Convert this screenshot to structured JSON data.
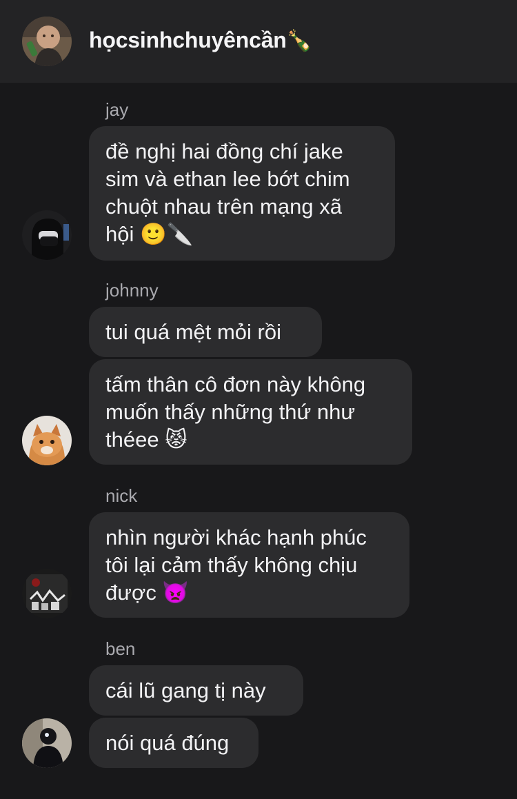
{
  "header": {
    "title": "họcsinhchuyêncần",
    "title_emoji": "🍾",
    "avatar_icon": "group-avatar-photo"
  },
  "messages": [
    {
      "sender": "jay",
      "bubbles": [
        {
          "lines": [
            "đề nghị hai đồng chí jake",
            "sim và ethan lee bớt chim",
            "chuột nhau trên mạng xã",
            "hội 🙂🔪"
          ]
        }
      ],
      "avatar_icon": "masked-person-avatar"
    },
    {
      "sender": "johnny",
      "bubbles": [
        {
          "lines": [
            "tui quá mệt mỏi rồi"
          ]
        },
        {
          "lines": [
            "tấm thân cô đơn này không",
            "muốn thấy những thứ như",
            "théee 😾"
          ]
        }
      ],
      "avatar_icon": "cat-avatar"
    },
    {
      "sender": "nick",
      "bubbles": [
        {
          "lines": [
            "nhìn người khác hạnh phúc",
            "tôi lại cảm thấy không chịu",
            "được 👿"
          ]
        }
      ],
      "avatar_icon": "graffiti-avatar"
    },
    {
      "sender": "ben",
      "bubbles": [
        {
          "lines": [
            "cái lũ gang tị này"
          ]
        },
        {
          "lines": [
            "nói quá đúng"
          ]
        }
      ],
      "avatar_icon": "dark-person-avatar"
    }
  ],
  "colors": {
    "background": "#18181a",
    "header": "#232325",
    "bubble": "#2c2c2e",
    "sender_text": "#a9a9ae",
    "message_text": "#f2f2f4"
  }
}
